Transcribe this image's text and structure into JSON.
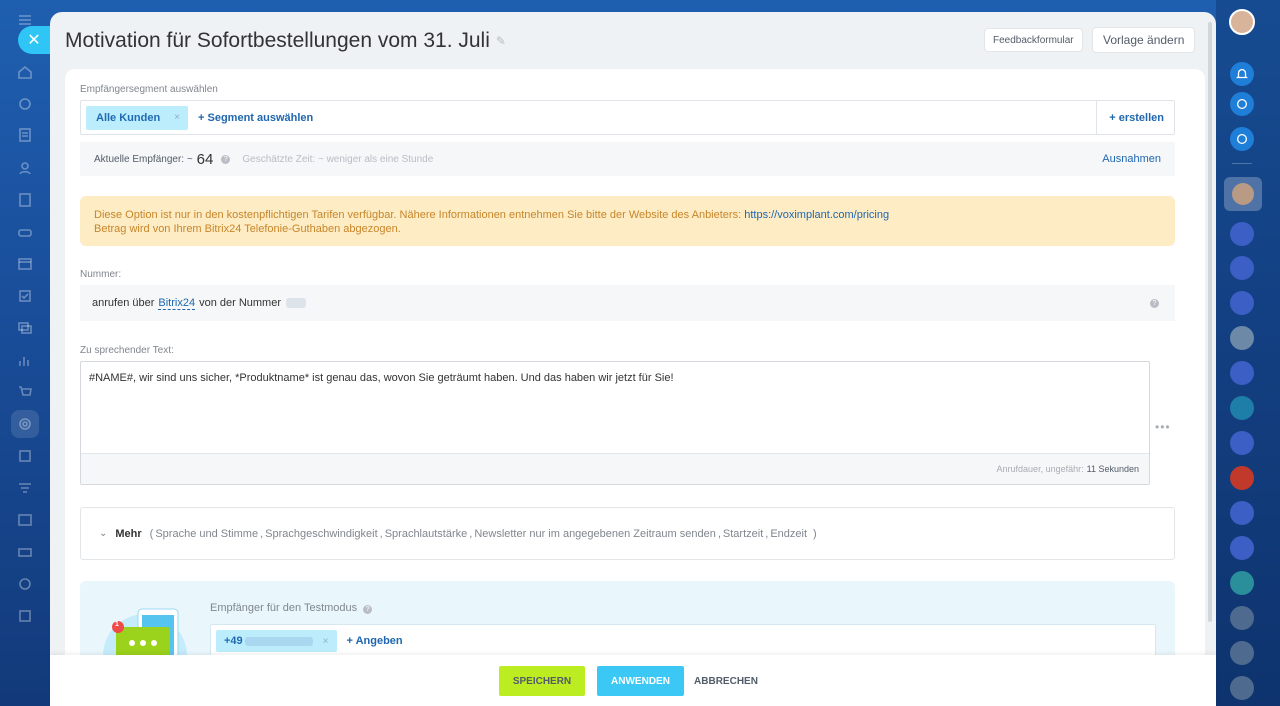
{
  "header": {
    "title": "Motivation für Sofortbestellungen vom 31. Juli",
    "feedback_label": "Feedbackformular",
    "vorlage_label": "Vorlage ändern"
  },
  "segment": {
    "label": "Empfängersegment auswählen",
    "tag": "Alle Kunden",
    "tag_close": "×",
    "select_link": "+ Segment auswählen",
    "create_link": "+ erstellen"
  },
  "recipients": {
    "label": "Aktuelle Empfänger: ~",
    "count": "64",
    "estimate": "Geschätzte Zeit: ~ weniger als eine Stunde",
    "exceptions": "Ausnahmen"
  },
  "warning": {
    "line1": "Diese Option ist nur in den kostenpflichtigen Tarifen verfügbar. Nähere Informationen entnehmen Sie bitte der Website des Anbieters:",
    "link": "https://voximplant.com/pricing",
    "line2": "Betrag wird von Ihrem Bitrix24 Telefonie-Guthaben abgezogen."
  },
  "number": {
    "label": "Nummer:",
    "prefix": "anrufen über",
    "provider": "Bitrix24",
    "suffix": "von der Nummer"
  },
  "text": {
    "label": "Zu sprechender Text:",
    "content": "#NAME#, wir sind uns sicher, *Produktname* ist genau das, wovon Sie geträumt haben. Und das haben wir jetzt für Sie!",
    "duration_label": "Anrufdauer, ungefähr:",
    "duration_value": "11 Sekunden"
  },
  "more": {
    "label": "Mehr",
    "open": "(",
    "close": ")",
    "options": [
      "Sprache und Stimme",
      "Sprachgeschwindigkeit",
      "Sprachlautstärke",
      "Newsletter nur im angegebenen Zeitraum senden",
      "Startzeit",
      "Endzeit"
    ]
  },
  "test": {
    "label": "Empfänger für den Testmodus",
    "phone_prefix": "+49",
    "add_link": "+ Angeben",
    "badge": "1"
  },
  "footer": {
    "save": "SPEICHERN",
    "apply": "ANWENDEN",
    "cancel": "ABBRECHEN"
  },
  "icons": {
    "left_rail": [
      "menu-icon",
      "home-icon",
      "feed-icon",
      "tasks-icon",
      "contacts-icon",
      "documents-icon",
      "car-icon",
      "calendar-icon",
      "checkbox-icon",
      "chat-icon",
      "chart-icon",
      "cart-icon",
      "marketing-icon",
      "inventory-icon",
      "filter-icon",
      "sites-icon",
      "contact-center-icon",
      "globe-icon",
      "apps-icon"
    ],
    "right_rail": [
      "avatar",
      "bell-icon",
      "sync-icon",
      "support-icon"
    ]
  },
  "colors": {
    "accent": "#2fc6f6",
    "save_button": "#bbed21",
    "apply_button": "#3bc8f5",
    "link": "#2067b0",
    "warning_bg": "#feecc4"
  }
}
